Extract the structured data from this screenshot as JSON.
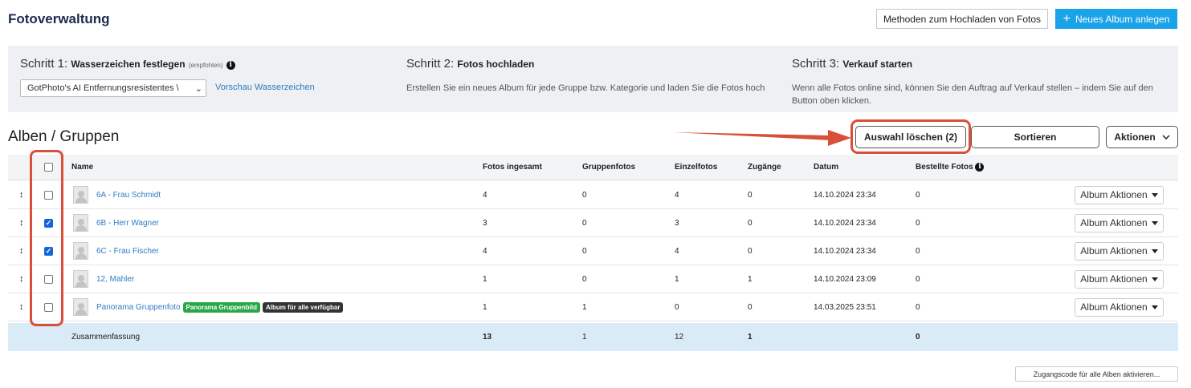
{
  "header": {
    "title": "Fotoverwaltung",
    "methods_button": "Methoden zum Hochladen von Fotos",
    "new_album_button": "Neues Album anlegen"
  },
  "steps": [
    {
      "prefix": "Schritt 1:",
      "title": "Wasserzeichen festlegen",
      "note": "(empfohlen)",
      "select_value": "GotPhoto's AI Entfernungsresistentes \\",
      "link": "Vorschau Wasserzeichen"
    },
    {
      "prefix": "Schritt 2:",
      "title": "Fotos hochladen",
      "description": "Erstellen Sie ein neues Album für jede Gruppe bzw. Kategorie und laden Sie die Fotos hoch"
    },
    {
      "prefix": "Schritt 3:",
      "title": "Verkauf starten",
      "description": "Wenn alle Fotos online sind, können Sie den Auftrag auf Verkauf stellen – indem Sie auf den Button oben klicken."
    }
  ],
  "albums": {
    "title": "Alben / Gruppen",
    "delete_selection_button": "Auswahl löschen (2)",
    "sort_button": "Sortieren",
    "actions_button": "Aktionen"
  },
  "table": {
    "columns": {
      "name": "Name",
      "total": "Fotos ingesamt",
      "group": "Gruppenfotos",
      "single": "Einzelfotos",
      "access": "Zugänge",
      "date": "Datum",
      "ordered": "Bestellte Fotos"
    },
    "rows": [
      {
        "name": "6A - Frau Schmidt",
        "total": "4",
        "group": "0",
        "single": "4",
        "access": "0",
        "date": "14.10.2024 23:34",
        "ordered": "0",
        "checked": false
      },
      {
        "name": "6B - Herr Wagner",
        "total": "3",
        "group": "0",
        "single": "3",
        "access": "0",
        "date": "14.10.2024 23:34",
        "ordered": "0",
        "checked": true
      },
      {
        "name": "6C - Frau Fischer",
        "total": "4",
        "group": "0",
        "single": "4",
        "access": "0",
        "date": "14.10.2024 23:34",
        "ordered": "0",
        "checked": true
      },
      {
        "name": "12, Mahler",
        "total": "1",
        "group": "0",
        "single": "1",
        "access": "1",
        "date": "14.10.2024 23:09",
        "ordered": "0",
        "checked": false
      },
      {
        "name": "Panorama Gruppenfoto",
        "total": "1",
        "group": "1",
        "single": "0",
        "access": "0",
        "date": "14.03.2025 23:51",
        "ordered": "0",
        "checked": false,
        "badges": [
          "Panorama Gruppenbild",
          "Album für alle verfügbar"
        ]
      }
    ],
    "row_action_button": "Album Aktionen",
    "summary": {
      "label": "Zusammenfassung",
      "total": "13",
      "group": "1",
      "single": "12",
      "access": "1",
      "ordered": "0"
    }
  },
  "footer": {
    "access_code_button": "Zugangscode für alle Alben aktivieren..."
  },
  "colors": {
    "primary": "#1aa3e8",
    "highlight": "#d9503a",
    "link": "#2f7cc4",
    "badge_green": "#27a745",
    "badge_dark": "#333333",
    "summary_bg": "#d9ebf6"
  }
}
